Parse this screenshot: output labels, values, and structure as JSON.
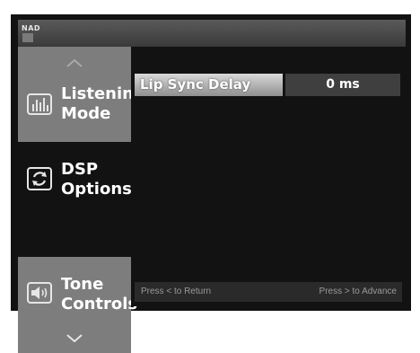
{
  "header": {
    "brand": "NAD"
  },
  "sidebar": {
    "items": [
      {
        "label_line1": "Listening",
        "label_line2": "Mode",
        "icon": "equalizer-icon",
        "selected": false
      },
      {
        "label_line1": "DSP",
        "label_line2": "Options",
        "icon": "refresh-icon",
        "selected": true
      },
      {
        "label_line1": "Tone",
        "label_line2": "Controls",
        "icon": "speaker-icon",
        "selected": false
      }
    ]
  },
  "main": {
    "setting": {
      "label": "Lip Sync Delay",
      "value": "0 ms"
    },
    "footer": {
      "left": "Press < to Return",
      "right": "Press > to Advance"
    }
  },
  "colors": {
    "background": "#121212",
    "panel": "#7d7d7d",
    "value_bg": "#3f3f3f",
    "text": "#ffffff"
  }
}
